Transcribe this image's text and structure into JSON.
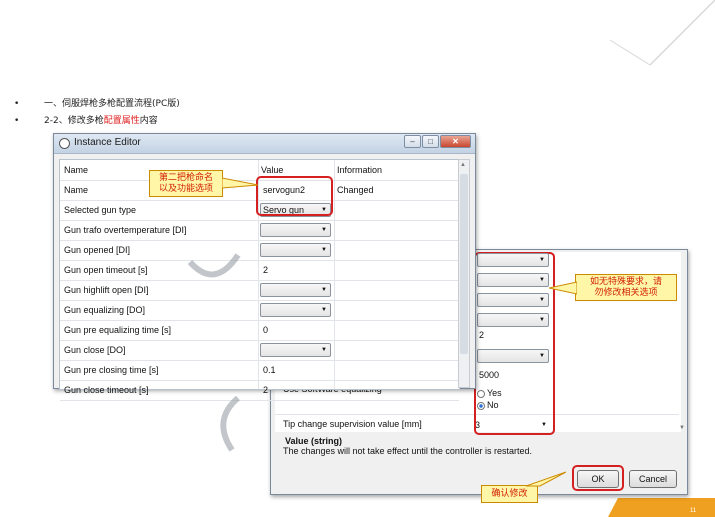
{
  "bullets": [
    {
      "prefix": "一、伺服焊枪多枪配置流程(PC版)"
    },
    {
      "prefix": "2-2、修改多枪",
      "highlight": "配置属性",
      "suffix": "内容"
    }
  ],
  "window1": {
    "title": "Instance Editor",
    "columns": {
      "name": "Name",
      "value": "Value",
      "information": "Information"
    },
    "rows": [
      {
        "name": "Name",
        "value": "servogun2",
        "info": "Changed",
        "kind": "text"
      },
      {
        "name": "Selected gun type",
        "value": "Servo gun",
        "info": "",
        "kind": "combo"
      },
      {
        "name": "Gun trafo overtemperature [DI]",
        "value": "",
        "info": "",
        "kind": "combo"
      },
      {
        "name": "Gun opened [DI]",
        "value": "",
        "info": "",
        "kind": "combo"
      },
      {
        "name": "Gun open timeout [s]",
        "value": "2",
        "info": "",
        "kind": "text"
      },
      {
        "name": "Gun highlift open [DI]",
        "value": "",
        "info": "",
        "kind": "combo"
      },
      {
        "name": "Gun equalizing [DO]",
        "value": "",
        "info": "",
        "kind": "combo"
      },
      {
        "name": "Gun pre equalizing time [s]",
        "value": "0",
        "info": "",
        "kind": "text"
      },
      {
        "name": "Gun close [DO]",
        "value": "",
        "info": "",
        "kind": "combo"
      },
      {
        "name": "Gun pre closing time [s]",
        "value": "0.1",
        "info": "",
        "kind": "text"
      },
      {
        "name": "Gun close timeout [s]",
        "value": "2",
        "info": "",
        "kind": "text"
      }
    ]
  },
  "window2": {
    "values": [
      {
        "kind": "combo",
        "value": ""
      },
      {
        "kind": "combo",
        "value": ""
      },
      {
        "kind": "combo",
        "value": ""
      },
      {
        "kind": "combo",
        "value": ""
      },
      {
        "kind": "text",
        "value": "2"
      },
      {
        "kind": "combo",
        "value": ""
      },
      {
        "kind": "text",
        "value": "5000"
      }
    ],
    "equalizing_label": "Use SoftWare equalizing",
    "radio_yes": "Yes",
    "radio_no": "No",
    "radio_selected": "No",
    "tip_label": "Tip change supervision value [mm]",
    "tip_value": "3",
    "desc_title": "Value (string)",
    "desc_text": "The changes will not take effect until the controller is restarted.",
    "ok_label": "OK",
    "cancel_label": "Cancel"
  },
  "callouts": {
    "gun_name": "第二把枪命名\n以及功能选项",
    "no_change": "如无特殊要求，请\n勿修改相关选项",
    "confirm": "确认修改"
  },
  "page_number": "11",
  "colors": {
    "highlight_red": "#e02020",
    "callout_bg": "#fff6a8",
    "accent_orange": "#f0a020"
  }
}
